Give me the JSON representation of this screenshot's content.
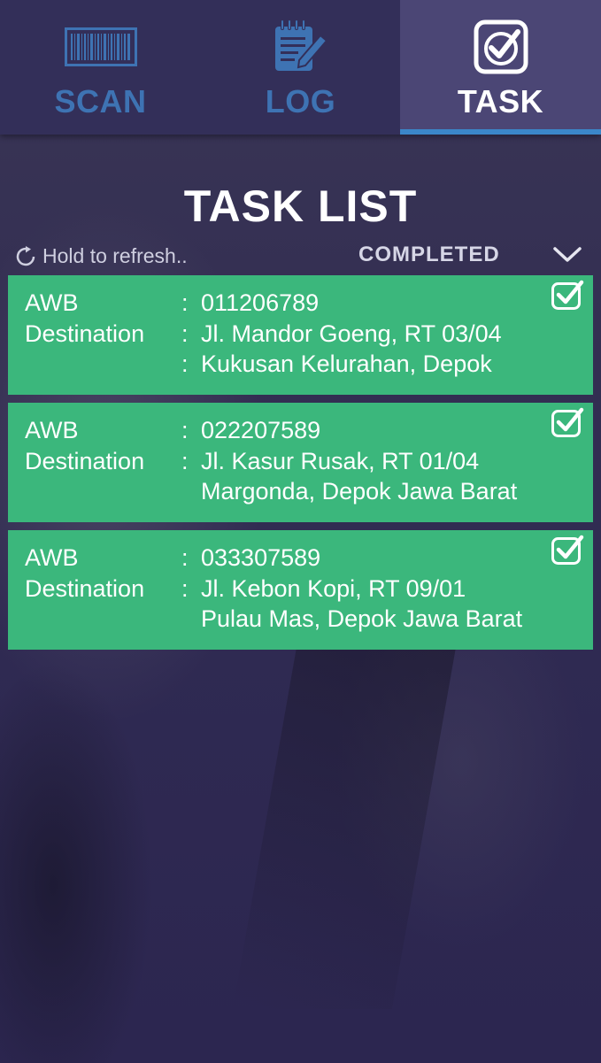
{
  "tabs": [
    {
      "label": "SCAN",
      "icon": "barcode-icon",
      "active": false
    },
    {
      "label": "LOG",
      "icon": "notepad-pencil-icon",
      "active": false
    },
    {
      "label": "TASK",
      "icon": "checkbox-icon",
      "active": true
    }
  ],
  "page": {
    "title": "TASK LIST",
    "refresh_hint": "Hold to refresh..",
    "filter_value": "COMPLETED"
  },
  "tasks": [
    {
      "awb_label": "AWB",
      "awb_colon": ":",
      "awb": "011206789",
      "dest_label": "Destination",
      "dest_colon": ":",
      "dest_line1": "Jl. Mandor Goeng, RT 03/04",
      "dest_line2_colon": ":",
      "dest_line2": "Kukusan Kelurahan, Depok",
      "completed": true
    },
    {
      "awb_label": "AWB",
      "awb_colon": ":",
      "awb": "022207589",
      "dest_label": "Destination",
      "dest_colon": ":",
      "dest_line1": "Jl. Kasur Rusak, RT 01/04",
      "dest_line2_colon": "",
      "dest_line2": "Margonda, Depok Jawa Barat",
      "completed": true
    },
    {
      "awb_label": "AWB",
      "awb_colon": ":",
      "awb": "033307589",
      "dest_label": "Destination",
      "dest_colon": ":",
      "dest_line1": "Jl. Kebon Kopi, RT 09/01",
      "dest_line2_colon": "",
      "dest_line2": "Pulau Mas, Depok Jawa Barat",
      "completed": true
    }
  ],
  "colors": {
    "tabbar_bg": "#332f59",
    "active_tab_bg": "#4b4675",
    "inactive_tab_text": "#3e73b3",
    "active_underline": "#3b86c9",
    "card_bg": "#3bb77c"
  }
}
